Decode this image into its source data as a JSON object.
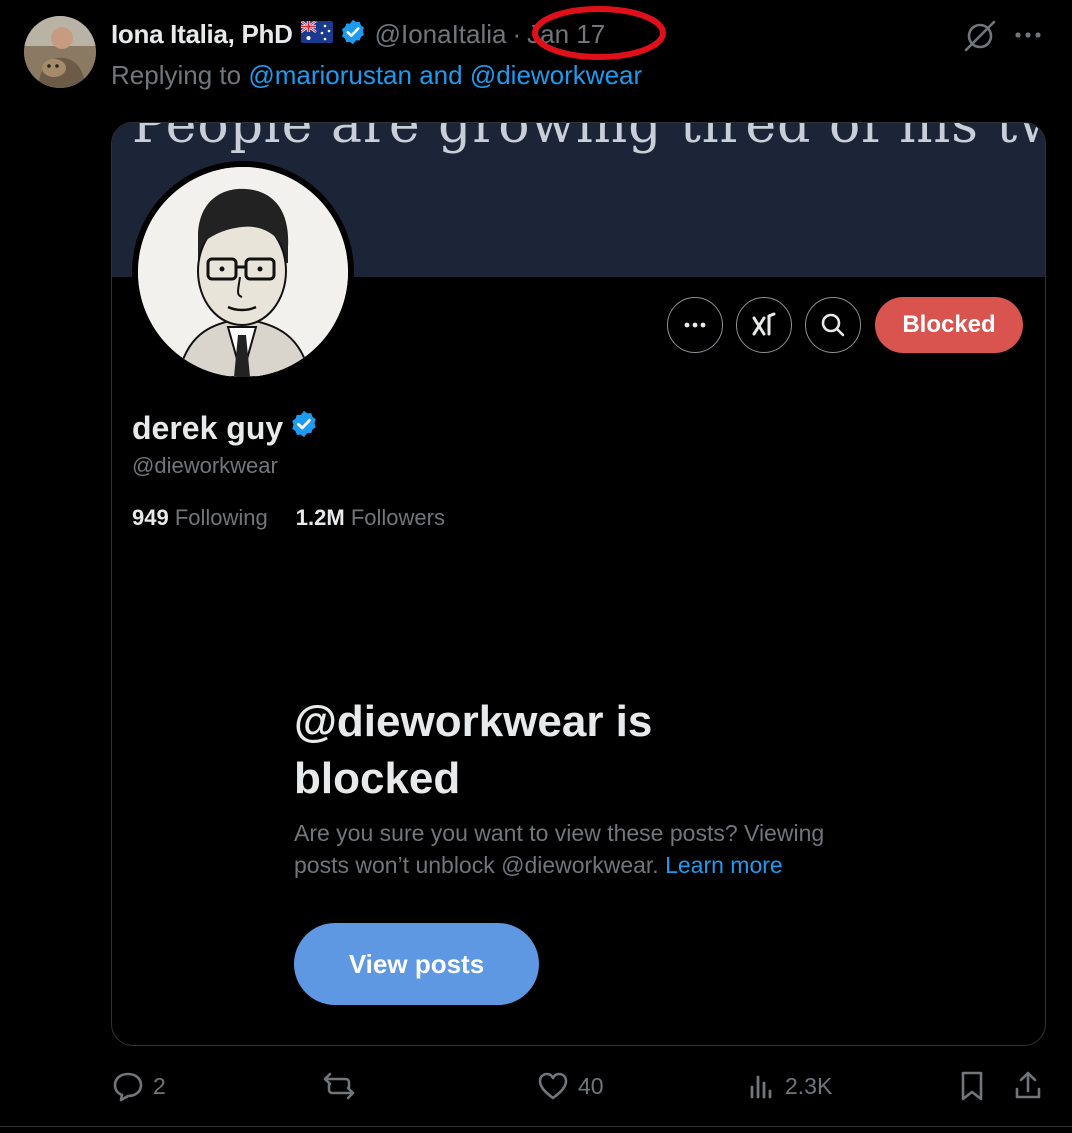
{
  "post": {
    "author": {
      "name": "Iona Italia, PhD",
      "flag": "australia-flag-icon",
      "handle": "@IonaItalia",
      "dot": "·",
      "date": "Jan 17"
    },
    "reply": {
      "prefix": "Replying to ",
      "mention1": "@mariorustan",
      "and": " and ",
      "mention2": "@dieworkwear"
    },
    "card": {
      "banner_text": "People are growing tired of his tweets.",
      "profile": {
        "name": "derek guy",
        "handle": "@dieworkwear",
        "following_count": "949",
        "following_label": "Following",
        "followers_count": "1.2M",
        "followers_label": "Followers"
      },
      "blocked_button": "Blocked",
      "blocked_title": "@dieworkwear is blocked",
      "blocked_desc": "Are you sure you want to view these posts? Viewing posts won’t unblock @dieworkwear.",
      "learn_more": "Learn more",
      "view_posts": "View posts"
    },
    "actions": {
      "replies": "2",
      "reposts": "",
      "likes": "40",
      "views": "2.3K"
    }
  },
  "colors": {
    "background": "#000000",
    "accent": "#1d9bf0",
    "blocked": "#d9534f",
    "view_posts": "#5e98e3",
    "muted": "#71767b",
    "annotation": "#e0101b"
  }
}
